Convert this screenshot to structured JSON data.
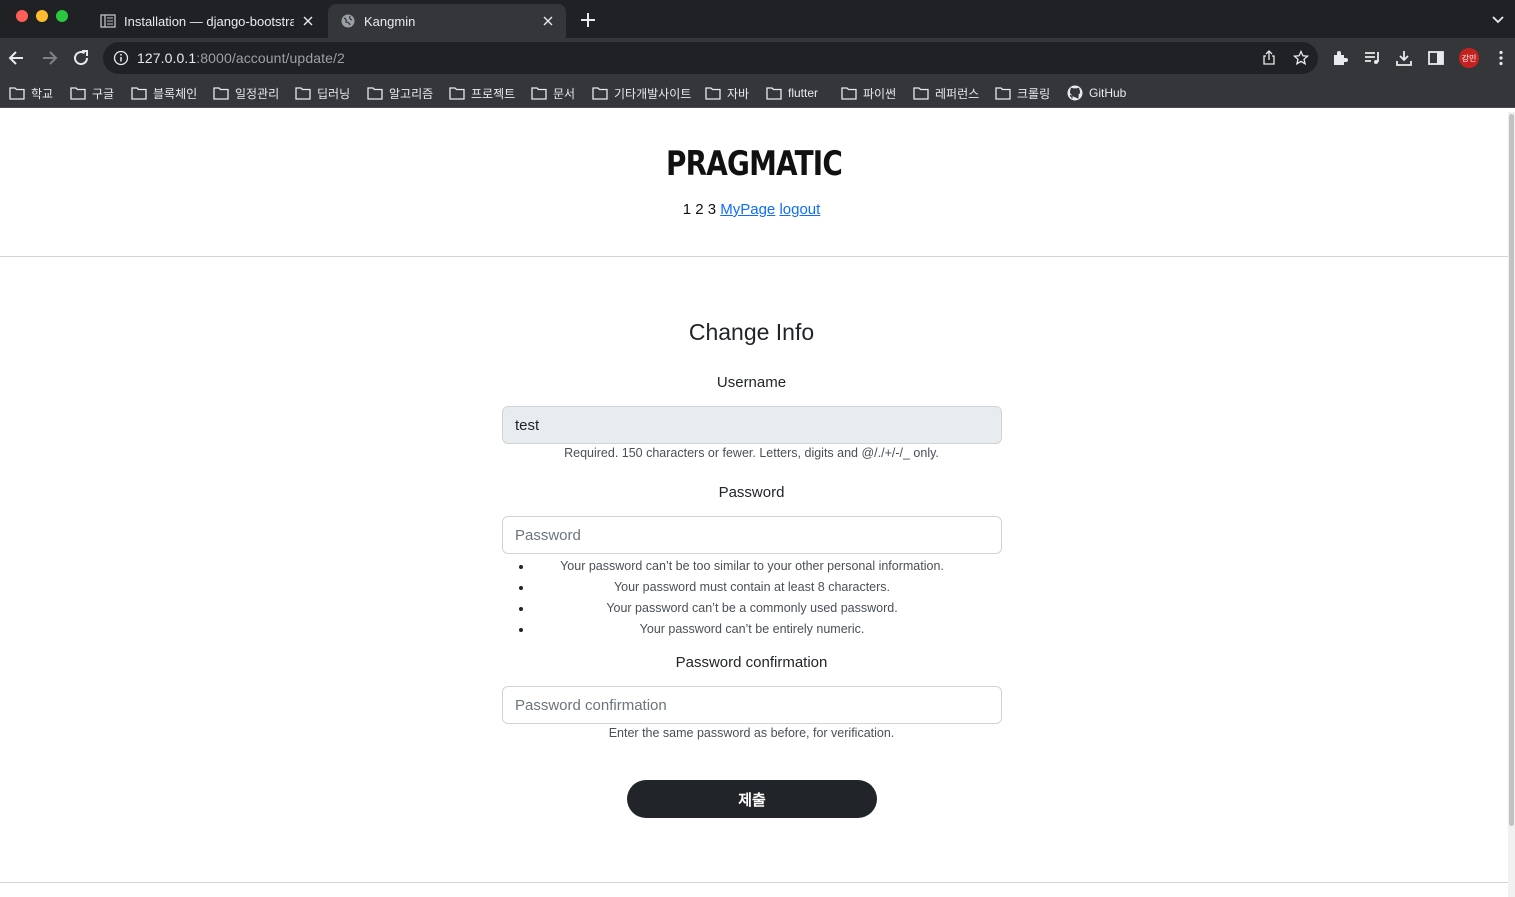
{
  "browser": {
    "tabs": [
      {
        "title": "Installation — django-bootstrap",
        "favicon": "docs-icon",
        "active": false
      },
      {
        "title": "Kangmin",
        "favicon": "globe-icon",
        "active": true
      }
    ],
    "url_host": "127.0.0.1",
    "url_path": ":8000/account/update/2",
    "profile_initials": "강민",
    "bookmarks": [
      "학교",
      "구글",
      "블록체인",
      "일정관리",
      "딥러닝",
      "알고리즘",
      "프로젝트",
      "문서",
      "기타개발사이트",
      "자바",
      "flutter",
      "파이썬",
      "레퍼런스",
      "크롤링",
      "GitHub"
    ]
  },
  "header": {
    "logo": "PRAGMATIC",
    "nav_plain": "1 2 3",
    "nav_links": [
      "MyPage",
      "logout"
    ]
  },
  "form": {
    "title": "Change Info",
    "username": {
      "label": "Username",
      "value": "test",
      "help": "Required. 150 characters or fewer. Letters, digits and @/./+/-/_ only."
    },
    "password": {
      "label": "Password",
      "placeholder": "Password",
      "help_items": [
        "Your password can’t be too similar to your other personal information.",
        "Your password must contain at least 8 characters.",
        "Your password can’t be a commonly used password.",
        "Your password can’t be entirely numeric."
      ]
    },
    "password_confirm": {
      "label": "Password confirmation",
      "placeholder": "Password confirmation",
      "help": "Enter the same password as before, for verification."
    },
    "submit_label": "제출"
  },
  "colors": {
    "chrome_dark": "#202124",
    "chrome_toolbar": "#35363a",
    "link": "#0d6efd",
    "button_bg": "#212529",
    "profile": "#c5221f"
  }
}
